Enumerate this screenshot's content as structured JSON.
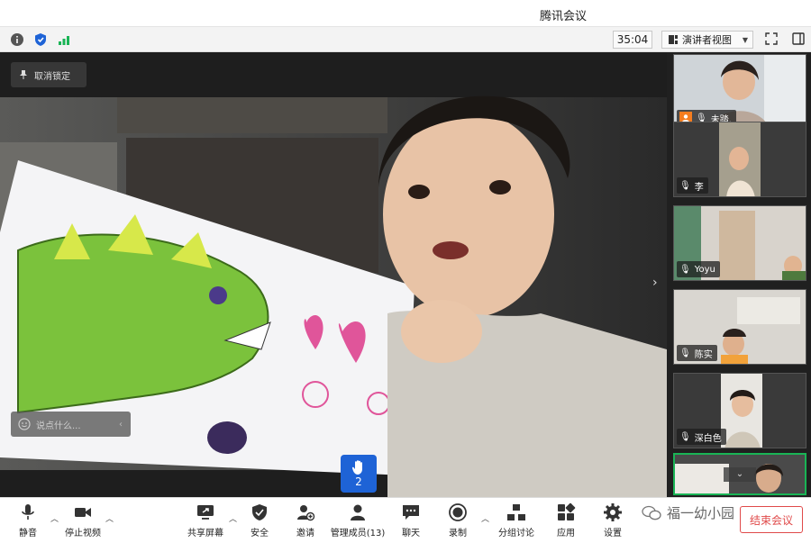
{
  "window": {
    "title": "腾讯会议"
  },
  "infobar": {
    "timer": "35:04",
    "view_mode": "演讲者视图"
  },
  "main": {
    "unpin_label": "取消锁定",
    "chat_placeholder": "说点什么...",
    "raised_hand_count": "2"
  },
  "participants": [
    {
      "name": "未踏."
    },
    {
      "name": "李"
    },
    {
      "name": "Yoyu"
    },
    {
      "name": "陈实"
    },
    {
      "name": "深白色"
    }
  ],
  "toolbar": {
    "mute": "静音",
    "stop_video": "停止视频",
    "share_screen": "共享屏幕",
    "security": "安全",
    "invite": "邀请",
    "members": "管理成员(13)",
    "chat": "聊天",
    "record": "录制",
    "breakout": "分组讨论",
    "apps": "应用",
    "settings": "设置",
    "end_meeting": "结束会议"
  },
  "watermark": {
    "text": "福一幼小园"
  },
  "colors": {
    "accent": "#1e63d6",
    "active_border": "#19b455",
    "end_red": "#e04a4a"
  },
  "icons": [
    "info-icon",
    "shield-icon",
    "signal-icon",
    "layout-icon",
    "fullscreen-icon",
    "sidebar-icon",
    "pin-icon",
    "smile-icon",
    "hand-icon",
    "mic-icon",
    "camera-icon",
    "share-icon",
    "security-icon",
    "invite-icon",
    "members-icon",
    "chat-icon",
    "record-icon",
    "breakout-icon",
    "apps-icon",
    "settings-icon"
  ]
}
